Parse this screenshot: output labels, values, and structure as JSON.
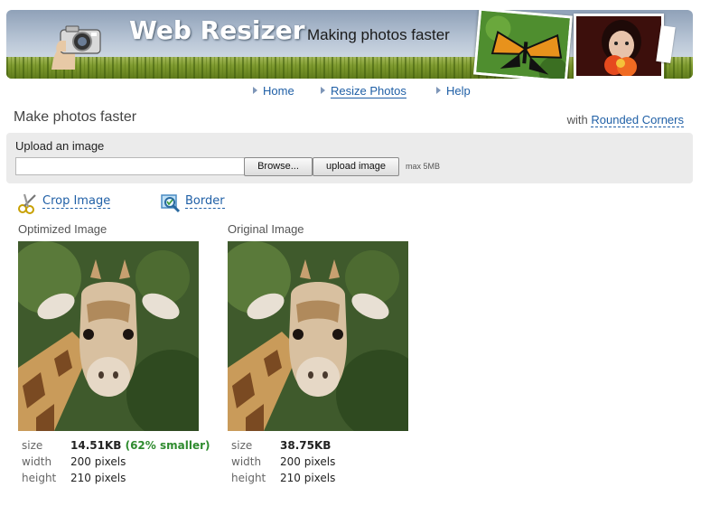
{
  "header": {
    "brand": "Web Resizer",
    "tagline": "Making photos faster"
  },
  "nav": {
    "items": [
      {
        "label": "Home",
        "active": false
      },
      {
        "label": "Resize Photos",
        "active": true
      },
      {
        "label": "Help",
        "active": false
      }
    ]
  },
  "page": {
    "title": "Make photos faster",
    "corners_prefix": "with",
    "corners_link": "Rounded Corners"
  },
  "upload": {
    "label": "Upload an image",
    "browse_label": "Browse...",
    "upload_label": "upload image",
    "max_note": "max 5MB"
  },
  "tools": {
    "crop_label": "Crop Image",
    "border_label": "Border"
  },
  "images": {
    "optimized": {
      "caption": "Optimized Image",
      "size_key": "size",
      "size_value": "14.51KB",
      "size_note": "(62% smaller)",
      "width_key": "width",
      "width_value": "200 pixels",
      "height_key": "height",
      "height_value": "210 pixels"
    },
    "original": {
      "caption": "Original Image",
      "size_key": "size",
      "size_value": "38.75KB",
      "width_key": "width",
      "width_value": "200 pixels",
      "height_key": "height",
      "height_value": "210 pixels"
    }
  },
  "colors": {
    "link": "#1f5fa6",
    "savings": "#2e8b2e",
    "panel": "#ebebeb"
  }
}
